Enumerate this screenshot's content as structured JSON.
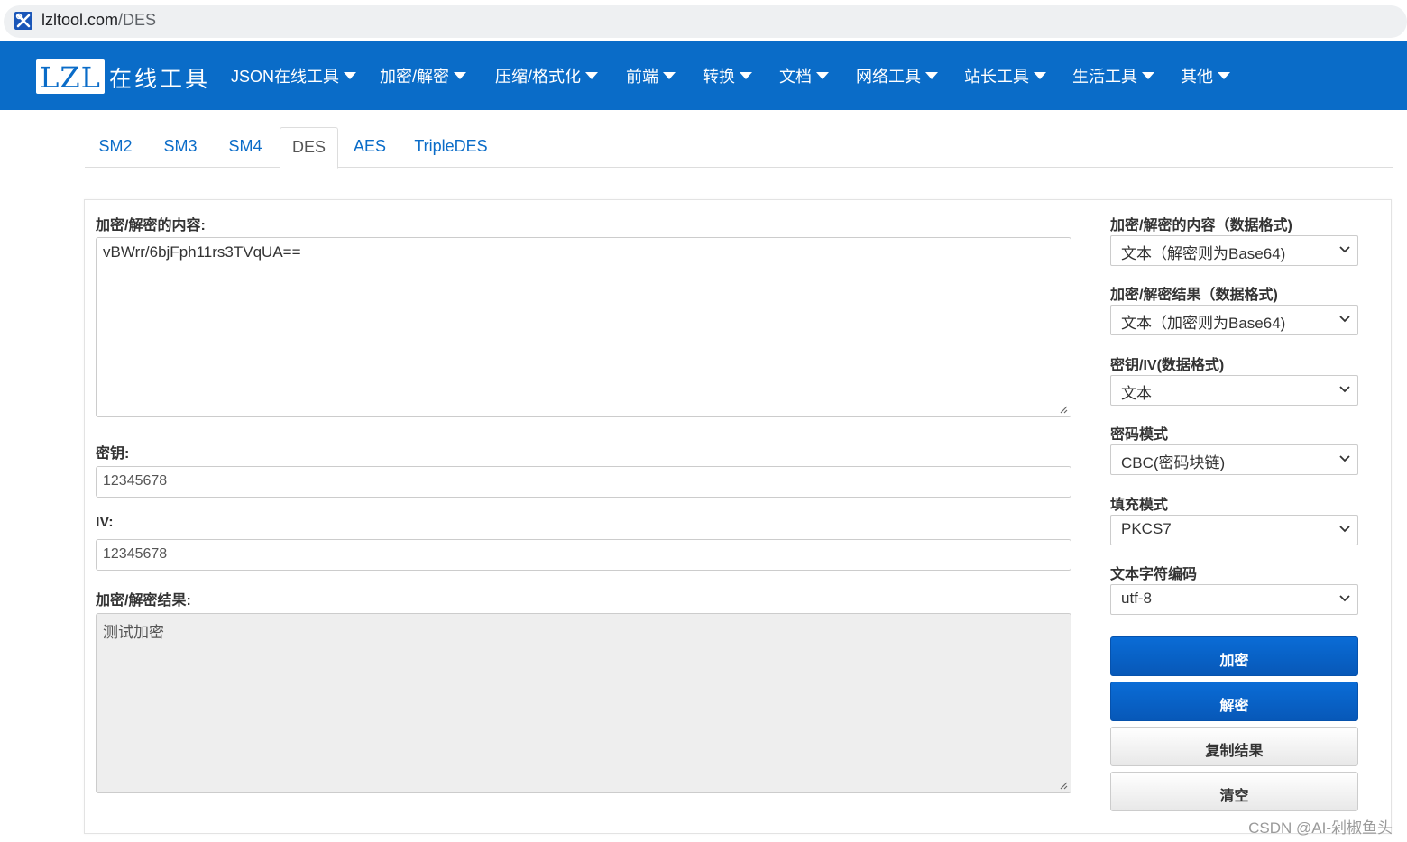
{
  "browser": {
    "url_host": "lzltool.com",
    "url_path": "/DES"
  },
  "navbar": {
    "logo": "LZL",
    "logo_text": "在线工具",
    "items": [
      {
        "label": "JSON在线工具"
      },
      {
        "label": "加密/解密"
      },
      {
        "label": "压缩/格式化"
      },
      {
        "label": "前端"
      },
      {
        "label": "转换"
      },
      {
        "label": "文档"
      },
      {
        "label": "网络工具"
      },
      {
        "label": "站长工具"
      },
      {
        "label": "生活工具"
      },
      {
        "label": "其他"
      }
    ]
  },
  "tabs": [
    {
      "label": "SM2",
      "active": false
    },
    {
      "label": "SM3",
      "active": false
    },
    {
      "label": "SM4",
      "active": false
    },
    {
      "label": "DES",
      "active": true
    },
    {
      "label": "AES",
      "active": false
    },
    {
      "label": "TripleDES",
      "active": false
    }
  ],
  "form": {
    "content_label": "加密/解密的内容:",
    "content_value": "vBWrr/6bjFph11rs3TVqUA==",
    "key_label": "密钥:",
    "key_value": "12345678",
    "iv_label": "IV:",
    "iv_value": "12345678",
    "result_label": "加密/解密结果:",
    "result_value": "测试加密"
  },
  "options": {
    "content_format_label": "加密/解密的内容（数据格式)",
    "content_format_value": "文本（解密则为Base64)",
    "result_format_label": "加密/解密结果（数据格式)",
    "result_format_value": "文本（加密则为Base64)",
    "key_format_label": "密钥/IV(数据格式)",
    "key_format_value": "文本",
    "mode_label": "密码模式",
    "mode_value": "CBC(密码块链)",
    "padding_label": "填充模式",
    "padding_value": "PKCS7",
    "encoding_label": "文本字符编码",
    "encoding_value": "utf-8"
  },
  "buttons": {
    "encrypt": "加密",
    "decrypt": "解密",
    "copy": "复制结果",
    "clear": "清空"
  },
  "watermark": "CSDN @AI-剁椒鱼头",
  "colors": {
    "brand": "#0a6cc8",
    "primary_button": "#0758b8"
  }
}
